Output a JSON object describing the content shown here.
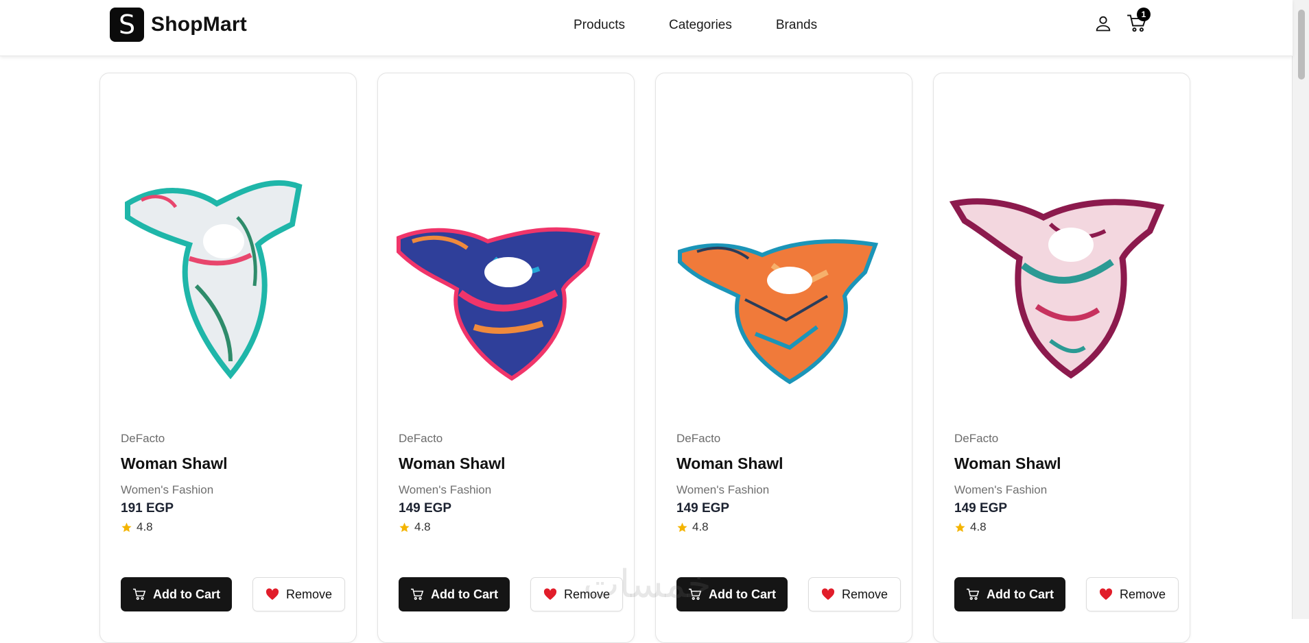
{
  "header": {
    "logo_letter": "S",
    "logo_text": "ShopMart",
    "nav": [
      "Products",
      "Categories",
      "Brands"
    ],
    "cart_count": "1"
  },
  "products": [
    {
      "brand": "DeFacto",
      "title": "Woman Shawl",
      "category": "Women's Fashion",
      "price": "191 EGP",
      "rating": "4.8",
      "palette": [
        "#e9edf0",
        "#1fb6a9",
        "#e8466d",
        "#2e8b6a"
      ]
    },
    {
      "brand": "DeFacto",
      "title": "Woman Shawl",
      "category": "Women's Fashion",
      "price": "149 EGP",
      "rating": "4.8",
      "palette": [
        "#2f3f9a",
        "#f0356a",
        "#f08a3c",
        "#24a8d6"
      ]
    },
    {
      "brand": "DeFacto",
      "title": "Woman Shawl",
      "category": "Women's Fashion",
      "price": "149 EGP",
      "rating": "4.8",
      "palette": [
        "#f07a3a",
        "#1b95b8",
        "#f6b06b",
        "#2a3d5a"
      ]
    },
    {
      "brand": "DeFacto",
      "title": "Woman Shawl",
      "category": "Women's Fashion",
      "price": "149 EGP",
      "rating": "4.8",
      "palette": [
        "#8c1a4d",
        "#f3d7df",
        "#2b9a94",
        "#c7325e"
      ]
    }
  ],
  "buttons": {
    "add_to_cart": "Add to Cart",
    "remove": "Remove"
  },
  "colors": {
    "accent": "#151515",
    "star": "#f4b400",
    "heart": "#e11d2a"
  },
  "icons": {
    "user": "user-icon",
    "cart": "cart-icon",
    "star": "star-icon",
    "heart": "heart-icon"
  },
  "watermark": "خمسات"
}
